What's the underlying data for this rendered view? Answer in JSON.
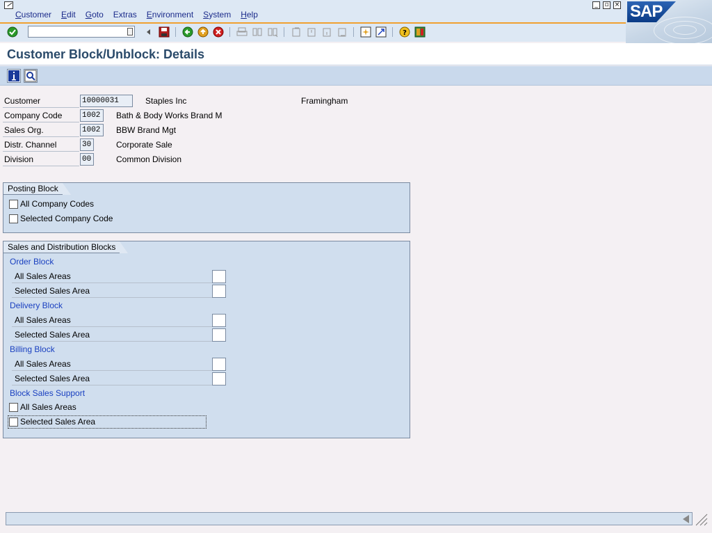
{
  "menu": [
    {
      "mnemonic": "C",
      "rest": "ustomer"
    },
    {
      "mnemonic": "E",
      "rest": "dit"
    },
    {
      "mnemonic": "G",
      "rest": "oto"
    },
    {
      "mnemonic": "",
      "rest": "Extras"
    },
    {
      "mnemonic": "E",
      "rest": "nvironment"
    },
    {
      "mnemonic": "S",
      "rest": "ystem"
    },
    {
      "mnemonic": "H",
      "rest": "elp"
    }
  ],
  "logo": {
    "text": "SAP"
  },
  "command_field": {
    "value": ""
  },
  "title": "Customer Block/Unblock: Details",
  "header": {
    "customer": {
      "label": "Customer",
      "value": "10000031",
      "name": "Staples Inc",
      "city": "Framingham"
    },
    "company_code": {
      "label": "Company Code",
      "value": "1002",
      "desc": "Bath & Body Works Brand M"
    },
    "sales_org": {
      "label": "Sales Org.",
      "value": "1002",
      "desc": "BBW Brand Mgt"
    },
    "distr_channel": {
      "label": "Distr. Channel",
      "value": "30",
      "desc": "Corporate Sale"
    },
    "division": {
      "label": "Division",
      "value": "00",
      "desc": "Common Division"
    }
  },
  "posting_block": {
    "title": "Posting Block",
    "all_company_codes": "All Company Codes",
    "selected_company_code": "Selected Company Code"
  },
  "sd_blocks": {
    "title": "Sales and Distribution Blocks",
    "order_block": {
      "title": "Order Block",
      "all": "All Sales Areas",
      "selected": "Selected Sales Area"
    },
    "delivery_block": {
      "title": "Delivery Block",
      "all": "All Sales Areas",
      "selected": "Selected Sales Area"
    },
    "billing_block": {
      "title": "Billing Block",
      "all": "All Sales Areas",
      "selected": "Selected Sales Area"
    },
    "sales_support": {
      "title": "Block Sales Support",
      "all": "All Sales Areas",
      "selected": "Selected Sales Area"
    }
  },
  "colors": {
    "accent": "#f0a030",
    "title": "#2a4a6a",
    "group_bg": "#d0deee",
    "subtitle": "#1a40c0"
  }
}
